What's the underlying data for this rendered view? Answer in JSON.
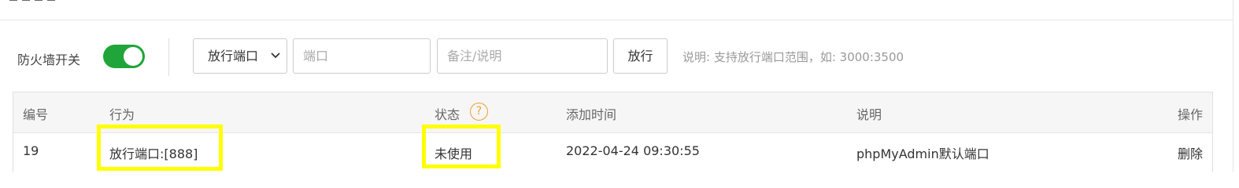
{
  "toolbar": {
    "firewall_label": "防火墙开关",
    "firewall_enabled": true,
    "action_select_value": "放行端口",
    "port_placeholder": "端口",
    "note_placeholder": "备注/说明",
    "submit_label": "放行",
    "hint": "说明: 支持放行端口范围，如: 3000:3500"
  },
  "table": {
    "headers": {
      "id": "编号",
      "action": "行为",
      "status": "状态",
      "added_time": "添加时间",
      "note": "说明",
      "operation": "操作"
    },
    "status_help_icon": "?",
    "rows": [
      {
        "id": "19",
        "action": "放行端口:[888]",
        "status": "未使用",
        "added_time": "2022-04-24 09:30:55",
        "note": "phpMyAdmin默认端口",
        "operation": "删除"
      }
    ]
  },
  "colors": {
    "accent_green": "#20a53a",
    "help_orange": "#f0a030",
    "highlight_yellow": "#ffff00"
  }
}
